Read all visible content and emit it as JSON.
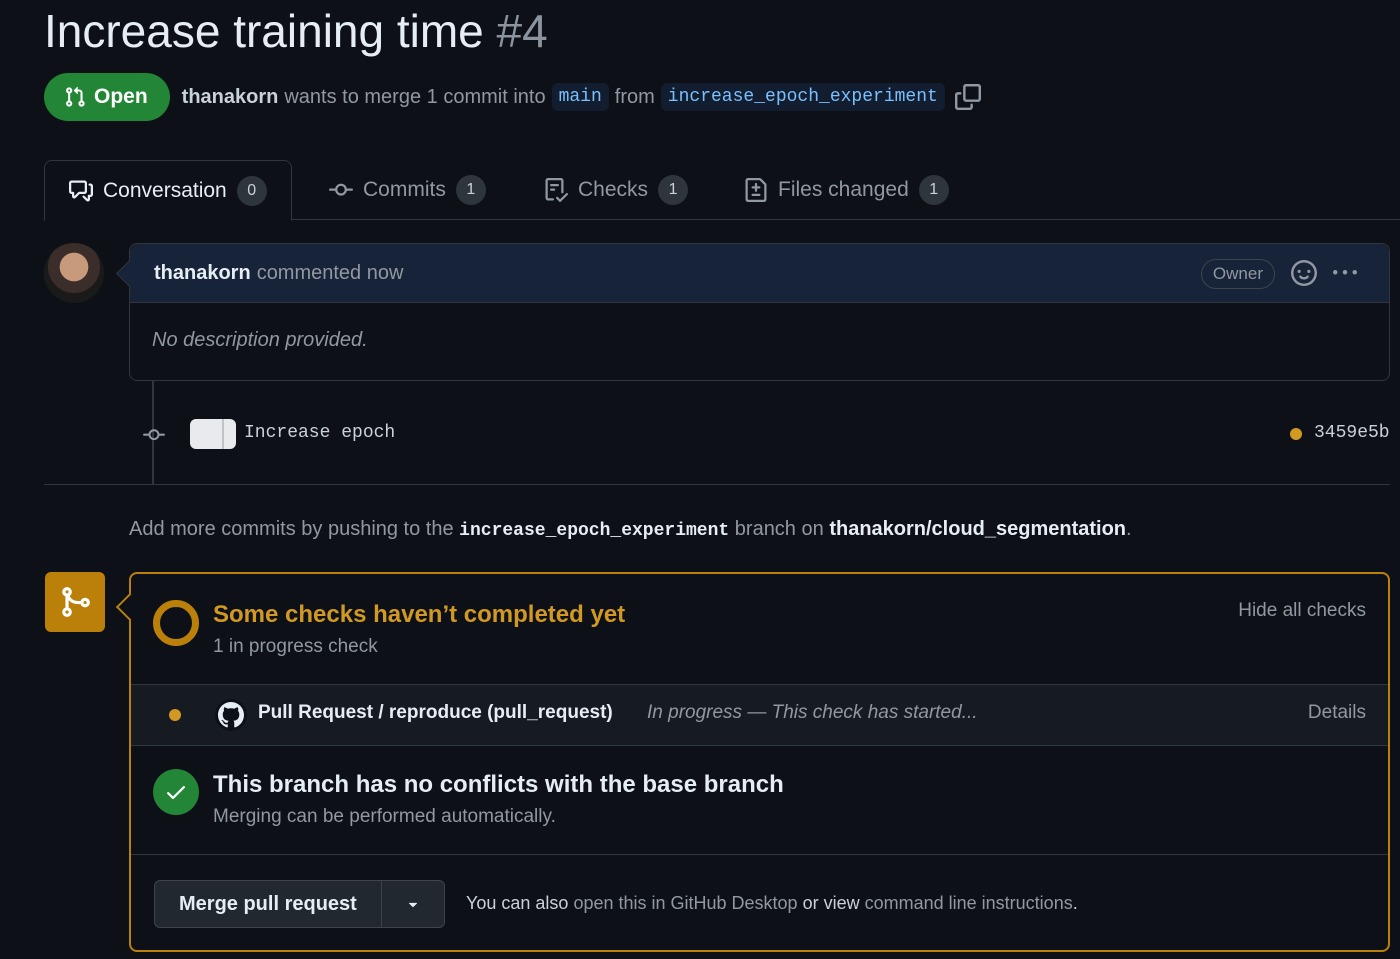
{
  "pr": {
    "title": "Increase training time",
    "number": "#4",
    "state": "Open",
    "author": "thanakorn",
    "merge_text_1": "wants to merge 1 commit into",
    "base_branch": "main",
    "merge_text_2": "from",
    "head_branch": "increase_epoch_experiment"
  },
  "tabs": [
    {
      "label": "Conversation",
      "count": "0",
      "icon": "comment-discussion-icon"
    },
    {
      "label": "Commits",
      "count": "1",
      "icon": "git-commit-icon"
    },
    {
      "label": "Checks",
      "count": "1",
      "icon": "checklist-icon"
    },
    {
      "label": "Files changed",
      "count": "1",
      "icon": "file-diff-icon"
    }
  ],
  "comment": {
    "author": "thanakorn",
    "time": "commented now",
    "role_badge": "Owner",
    "body": "No description provided."
  },
  "commit": {
    "message": "Increase epoch",
    "sha": "3459e5b"
  },
  "push_hint": {
    "prefix": "Add more commits by pushing to the",
    "branch": "increase_epoch_experiment",
    "middle": "branch on",
    "repo": "thanakorn/cloud_segmentation",
    "suffix": "."
  },
  "checks": {
    "title": "Some checks haven’t completed yet",
    "subtitle": "1 in progress check",
    "toggle": "Hide all checks",
    "items": [
      {
        "name": "Pull Request / reproduce (pull_request)",
        "status": "In progress — This check has started...",
        "link": "Details"
      }
    ]
  },
  "conflicts": {
    "title": "This branch has no conflicts with the base branch",
    "subtitle": "Merging can be performed automatically."
  },
  "merge": {
    "button": "Merge pull request",
    "note_1": "You can also",
    "link_1": "open this in GitHub Desktop",
    "note_2": "or view",
    "link_2": "command line instructions",
    "note_3": "."
  },
  "colors": {
    "open_green": "#238636",
    "pending_yellow": "#bb8009",
    "background": "#0d1117"
  }
}
